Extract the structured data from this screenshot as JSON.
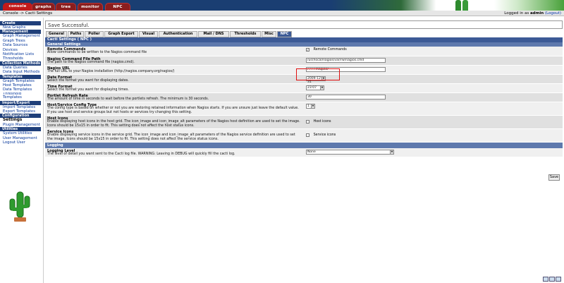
{
  "topnav": {
    "tabs": [
      {
        "label": "console",
        "active": true
      },
      {
        "label": "graphs",
        "active": false
      },
      {
        "label": "tree",
        "active": false
      },
      {
        "label": "monitor",
        "active": false
      },
      {
        "label": "NPC",
        "active": false
      }
    ]
  },
  "breadcrumb": "Console -> Cacti Settings",
  "login": {
    "prefix": "Logged in as",
    "user": "admin",
    "logout": "(Logout)"
  },
  "sidebar": {
    "sections": [
      {
        "header": "Create",
        "items": [
          "New Graphs"
        ]
      },
      {
        "header": "Management",
        "items": [
          "Graph Management",
          "Graph Trees",
          "Data Sources",
          "Devices",
          "Notification Lists",
          "Thresholds"
        ]
      },
      {
        "header": "Collection Methods",
        "items": [
          "Data Queries",
          "Data Input Methods"
        ]
      },
      {
        "header": "Templates",
        "items": [
          "Graph Templates",
          "Host Templates",
          "Data Templates",
          "Threshold Templates"
        ]
      },
      {
        "header": "Import/Export",
        "items": [
          "Import Templates",
          "Export Templates"
        ]
      },
      {
        "header": "Configuration",
        "items": [
          "Settings",
          "Plugin Management"
        ]
      },
      {
        "header": "Utilities",
        "items": [
          "System Utilities",
          "User Management",
          "Logout User"
        ]
      }
    ],
    "selected": "Settings"
  },
  "message": "Save Successful.",
  "settings_tabs": [
    "General",
    "Paths",
    "Poller",
    "Graph Export",
    "Visual",
    "Authentication",
    "Mail / DNS",
    "Thresholds",
    "Misc",
    "NPC"
  ],
  "active_tab": "NPC",
  "panel_title": "Cacti Settings ( NPC )",
  "general_section": "General Settings",
  "fields": {
    "remote_commands": {
      "title": "Remote Commands",
      "desc": "Allow commands to be written to the Nagios command file",
      "checkbox_label": "Remote Commands",
      "checked": true
    },
    "command_file": {
      "title": "Nagios Command File Path",
      "desc": "The path to the Nagios command file (nagios.cmd).",
      "value": "/usr/local/nagios/var/rw/nagios.cmd"
    },
    "nagios_url": {
      "title": "Nagios URL",
      "desc": "The full URL to your Nagios installation (http://nagios.company.org/nagios/)",
      "value": "/ / / / /nagios/"
    },
    "date_format": {
      "title": "Date Format",
      "desc": "Select the format you want for displaying dates.",
      "value": "2009-12-31"
    },
    "time_format": {
      "title": "Time Format",
      "desc": "Select the format you want for displaying times.",
      "value": "23:07"
    },
    "portlet_refresh": {
      "title": "Portlet Refresh Rate",
      "desc": "The amount of time in seconds to wait before the portlets refresh. The minimum is 30 seconds.",
      "value": "30"
    },
    "config_type": {
      "title": "Host/Service Config Type",
      "desc": "The config type is based on whether or not you are restoring retained information when Nagios starts. If you are unsure just leave the default value. If you use host and service groups but not hosts or services try changing this setting.",
      "value": "1"
    },
    "host_icons": {
      "title": "Host Icons",
      "desc": "Enable displaying host icons in the host grid. The icon_image and icon_image_alt parameters of the Nagios host definition are used to set the image. Icons should be 15x15 in order to fit. This setting does not affect the host status icons.",
      "checkbox_label": "Host icons",
      "checked": false
    },
    "service_icons": {
      "title": "Service Icons",
      "desc": "Enable displaying service icons in the service grid. The icon_image and icon_image_alt parameters of the Nagios service definition are used to set the image. Icons should be 15x15 in order to fit. This setting does not affect the service status icons.",
      "checkbox_label": "Service icons",
      "checked": false
    }
  },
  "logging_section": "Logging",
  "log_level": {
    "title": "Logging Level",
    "desc": "The level of detail you want sent to the Cacti log file. WARNING: Leaving in DEBUG will quickly fill the cacti log.",
    "value": "None"
  },
  "save_label": "Save",
  "colors": {
    "nav_blue": "#1a3e72",
    "tab_red": "#c21a1a",
    "header_blue": "#3c5a96",
    "highlight_red": "#e01010"
  }
}
